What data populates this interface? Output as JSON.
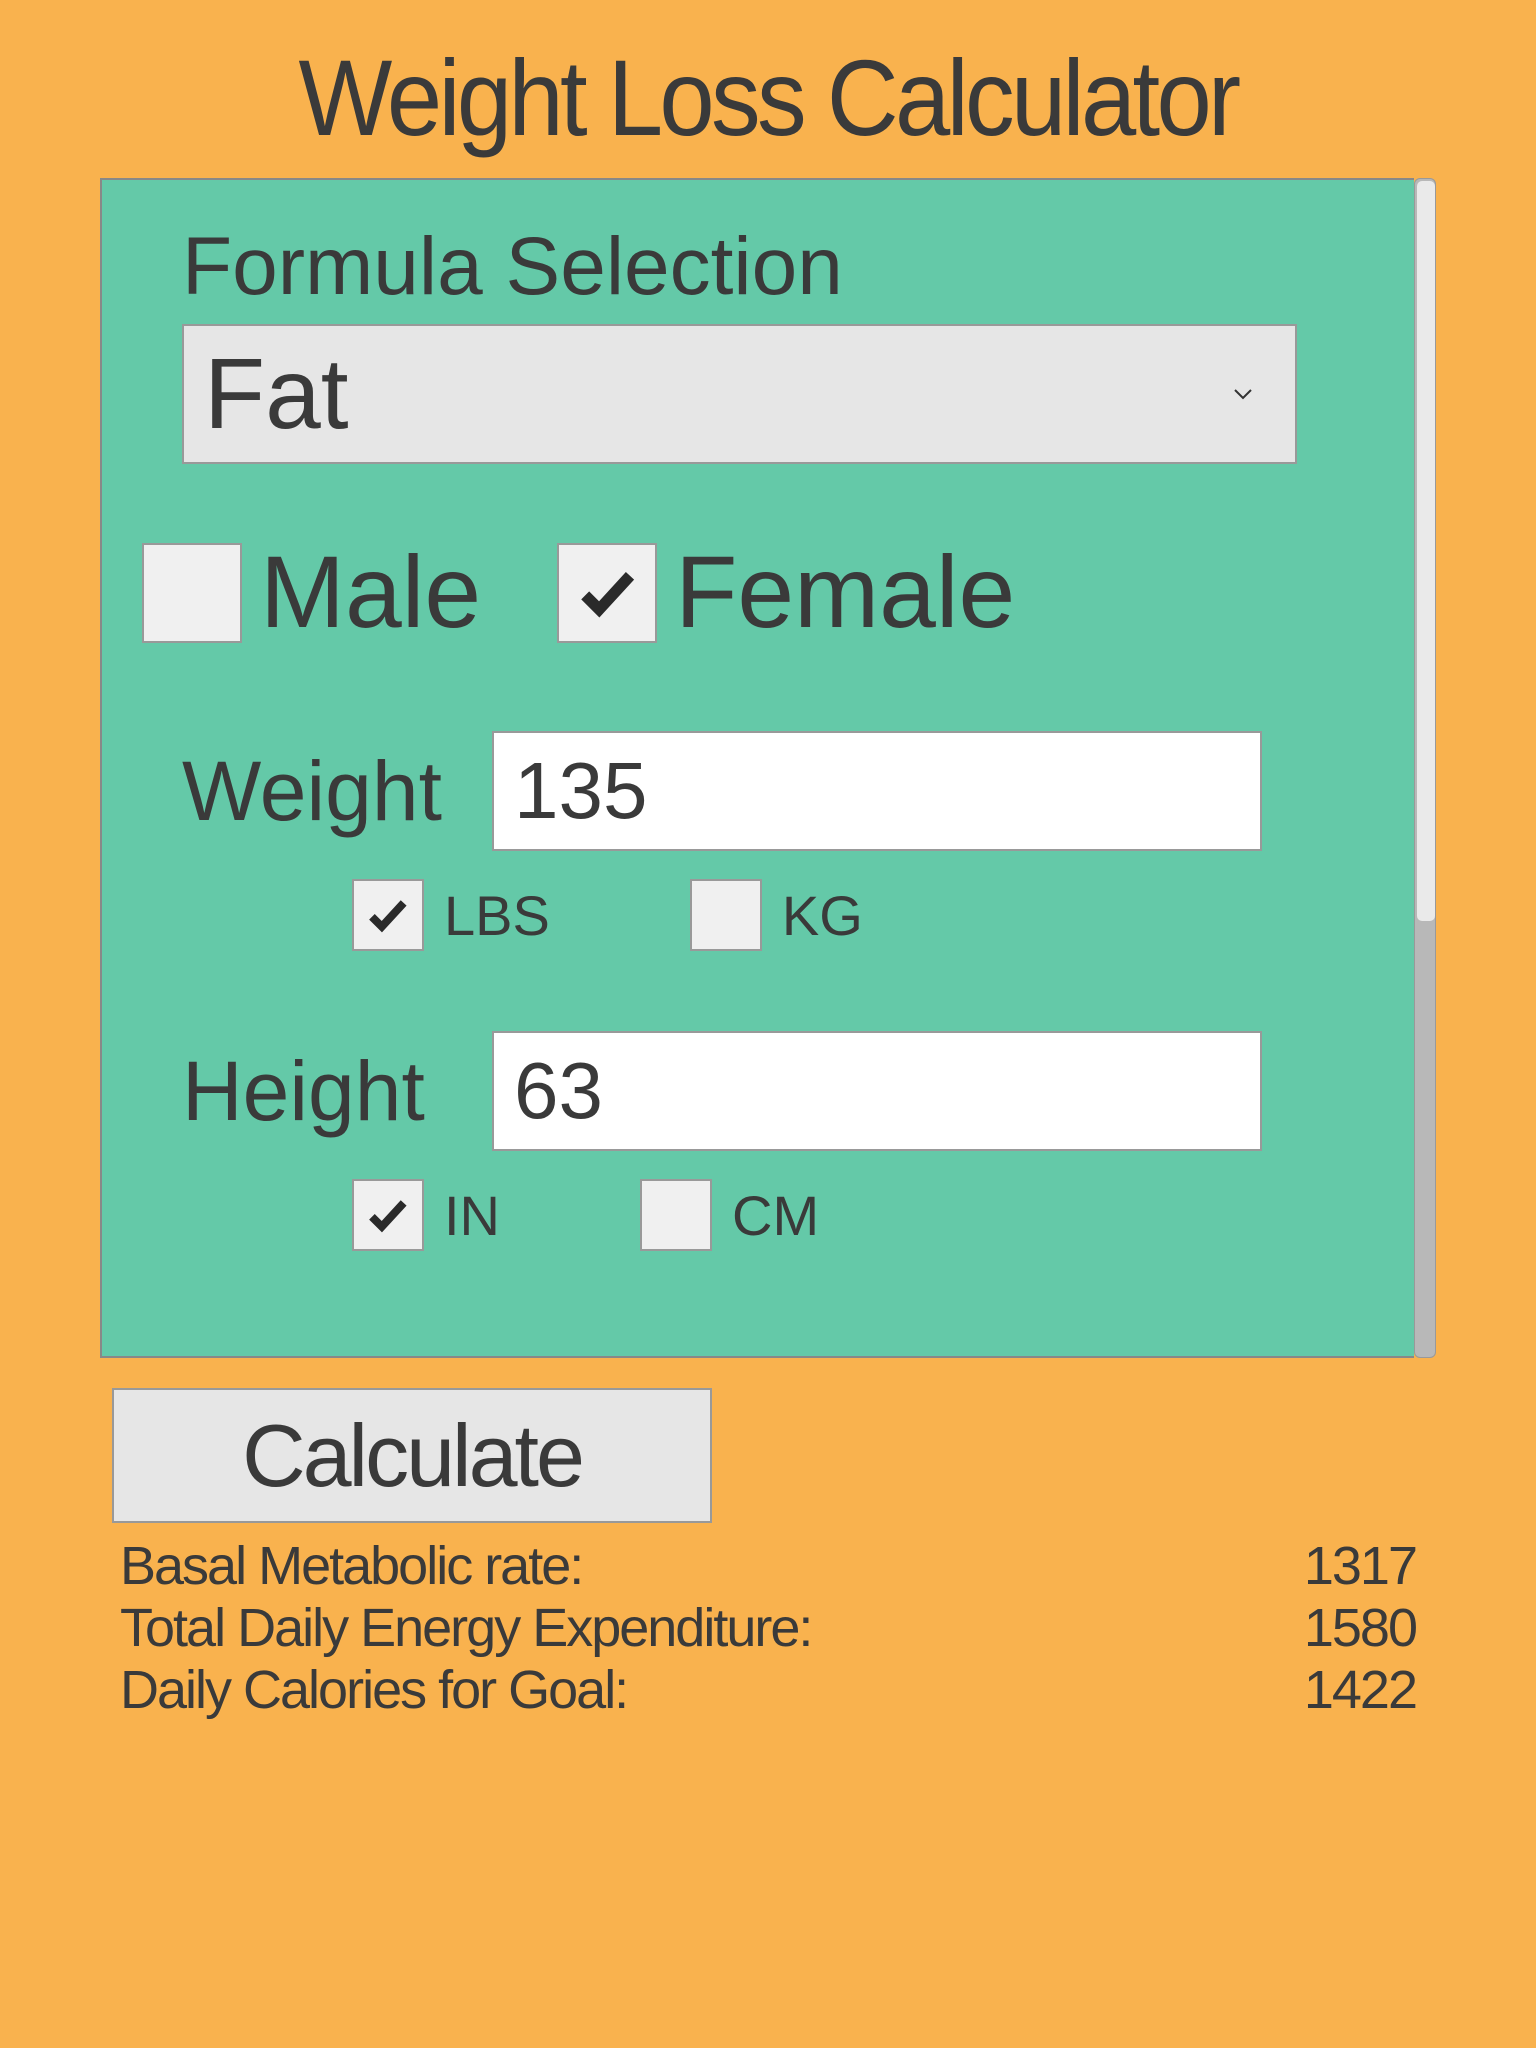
{
  "title": "Weight Loss Calculator",
  "formula": {
    "label": "Formula Selection",
    "selected": "Fat"
  },
  "gender": {
    "male_label": "Male",
    "female_label": "Female",
    "male_checked": false,
    "female_checked": true
  },
  "weight": {
    "label": "Weight",
    "value": "135",
    "unit_lbs_label": "LBS",
    "unit_kg_label": "KG",
    "lbs_checked": true,
    "kg_checked": false
  },
  "height": {
    "label": "Height",
    "value": "63",
    "unit_in_label": "IN",
    "unit_cm_label": "CM",
    "in_checked": true,
    "cm_checked": false
  },
  "calculate_label": "Calculate",
  "results": {
    "bmr_label": "Basal Metabolic rate:",
    "bmr_value": "1317",
    "tdee_label": "Total Daily Energy Expenditure:",
    "tdee_value": "1580",
    "goal_label": "Daily Calories for Goal:",
    "goal_value": "1422"
  }
}
